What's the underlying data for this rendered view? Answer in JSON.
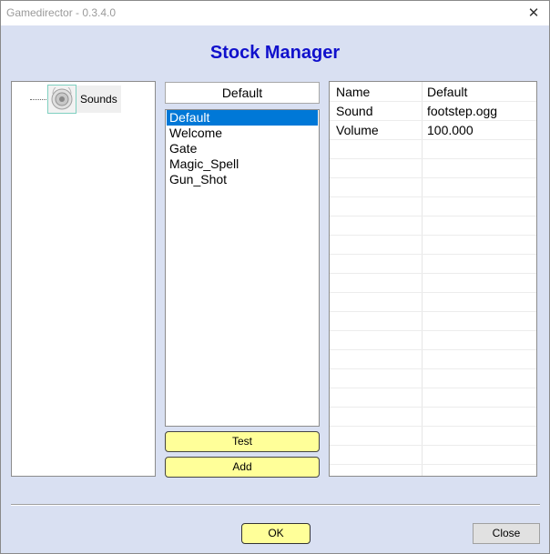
{
  "window": {
    "title": "Gamedirector - 0.3.4.0",
    "close_symbol": "✕"
  },
  "heading": "Stock Manager",
  "tree": {
    "items": [
      {
        "label": "Sounds",
        "icon": "speaker-icon"
      }
    ]
  },
  "stock_name": "Default",
  "stock_list": {
    "items": [
      "Default",
      "Welcome",
      "Gate",
      "Magic_Spell",
      "Gun_Shot"
    ],
    "selected": "Default"
  },
  "buttons": {
    "test": "Test",
    "add": "Add",
    "ok": "OK",
    "close": "Close"
  },
  "properties": [
    {
      "name": "Name",
      "value": "Default"
    },
    {
      "name": "Sound",
      "value": "footstep.ogg"
    },
    {
      "name": "Volume",
      "value": "100.000"
    }
  ],
  "colors": {
    "heading": "#1010cc",
    "selection": "#0078d7",
    "button_yellow": "#ffff99",
    "background": "#d9e0f2"
  }
}
